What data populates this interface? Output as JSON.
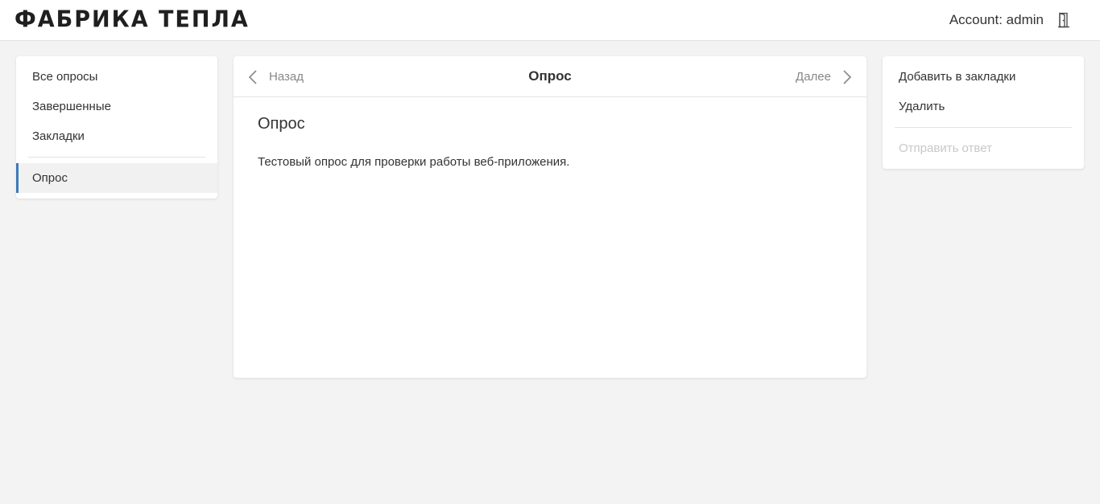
{
  "header": {
    "logo": "ФАБРИКА ТЕПЛА",
    "account_label": "Account: admin"
  },
  "left_nav": {
    "items": [
      {
        "label": "Все опросы"
      },
      {
        "label": "Завершенные"
      },
      {
        "label": "Закладки"
      }
    ],
    "active_item": {
      "label": "Опрос"
    }
  },
  "main": {
    "back_label": "Назад",
    "title": "Опрос",
    "next_label": "Далее",
    "survey_title": "Опрос",
    "survey_description": "Тестовый опрос для проверки работы веб-приложения."
  },
  "actions": {
    "bookmark_label": "Добавить в закладки",
    "delete_label": "Удалить",
    "submit_label": "Отправить ответ"
  },
  "colors": {
    "accent": "#3d7ab8",
    "background": "#f3f3f3",
    "disabled_text": "#c8c8c8"
  },
  "icons": {
    "back": "chevron-left-icon",
    "next": "chevron-right-icon",
    "logout": "door-exit-icon"
  }
}
